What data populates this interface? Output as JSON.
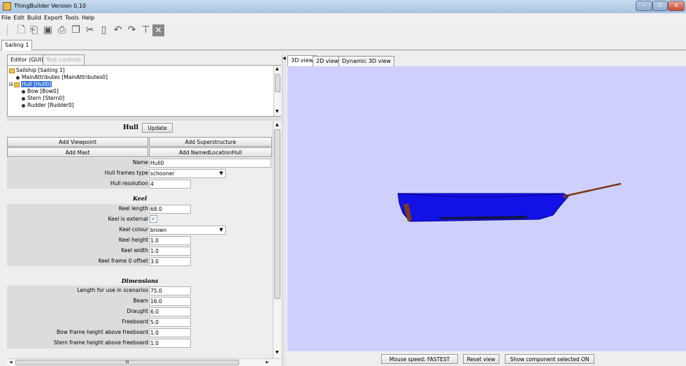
{
  "window": {
    "title": "ThingBuilder Version 0.10",
    "controls": {
      "minimize": "–",
      "maximize": "▫",
      "close": "x"
    }
  },
  "menu": [
    "File",
    "Edit",
    "Build",
    "Export",
    "Tools",
    "Help"
  ],
  "toolbar": {
    "icons": [
      "new-file-icon",
      "open-folder-icon",
      "save-icon",
      "print-icon",
      "copy-icon",
      "cut-icon",
      "paste-icon",
      "undo-icon",
      "redo-icon",
      "hammer-icon",
      "close-box-icon"
    ]
  },
  "document_tabs": [
    "Sailing 1"
  ],
  "left_tabs": [
    "Editor (GUI)",
    "Test controls"
  ],
  "tree": [
    {
      "label": "Sailship [Sailing 1]",
      "kind": "folder"
    },
    {
      "label": "MainAttributes [MainAttributes0]",
      "kind": "leaf"
    },
    {
      "label": "Hull [Hull0]",
      "kind": "folder",
      "selected": true
    },
    {
      "label": "Bow [Bow0]",
      "kind": "leaf"
    },
    {
      "label": "Stern [Stern0]",
      "kind": "leaf"
    },
    {
      "label": "Rudder [Rudder0]",
      "kind": "leaf"
    }
  ],
  "form": {
    "heading": "Hull",
    "update_button": "Update",
    "buttons": {
      "add_viewpoint": "Add Viewpoint",
      "add_superstructure": "Add Superstructure",
      "add_mast": "Add Mast",
      "add_named_location": "Add NamedLocationHull"
    },
    "general": [
      {
        "label": "Name",
        "value": "Hull0"
      },
      {
        "label": "Hull frames type",
        "value": "schooner",
        "type": "select"
      },
      {
        "label": "Hull resolution",
        "value": "4"
      }
    ],
    "keel_heading": "Keel",
    "keel": [
      {
        "label": "Keel length",
        "value": "68.0"
      },
      {
        "label": "Keel is external",
        "value": "✓",
        "type": "checkbox"
      },
      {
        "label": "Keel colour",
        "value": "brown",
        "type": "select"
      },
      {
        "label": "Keel height",
        "value": "1.0"
      },
      {
        "label": "Keel width",
        "value": "1.0"
      },
      {
        "label": "Keel frame 0 offset",
        "value": "3.0"
      }
    ],
    "dimensions_heading": "Dimensions",
    "dimensions": [
      {
        "label": "Length for use in scenarios",
        "value": "75.0"
      },
      {
        "label": "Beam",
        "value": "16.0"
      },
      {
        "label": "Draught",
        "value": "6.0"
      },
      {
        "label": "Freeboard",
        "value": "5.0"
      },
      {
        "label": "Bow frame height above freeboard",
        "value": "1.0"
      },
      {
        "label": "Stern frame height above freeboard",
        "value": "1.0"
      }
    ]
  },
  "hscroll_center": "III",
  "view_tabs": [
    "3D view",
    "2D view",
    "Dynamic 3D view"
  ],
  "view3d": {
    "background": "#cfcffb",
    "hull_color": "#1010e8",
    "keel_color": "#7a3a1a"
  },
  "bottom_buttons": {
    "mouse_speed": "Mouse speed: FASTEST",
    "reset_view": "Reset view",
    "show_component": "Show component selected  ON"
  }
}
